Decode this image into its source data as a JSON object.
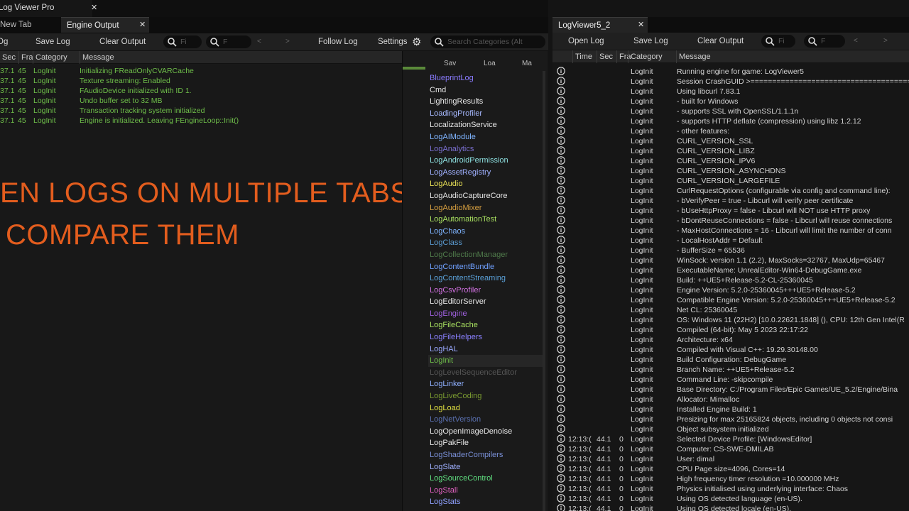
{
  "left": {
    "app_title": "Log Viewer Pro",
    "tabs": [
      "New Tab",
      "Engine Output"
    ],
    "toolbar": {
      "open_label": "Og",
      "save_label": "Save Log",
      "clear_label": "Clear Output",
      "search1_ph": "Fi",
      "search2_ph": "F",
      "follow_label": "Follow Log",
      "settings_label": "Settings"
    },
    "columns": [
      "Sec",
      "Fra",
      "Category",
      "Message"
    ],
    "rows": [
      {
        "sec": "37.1",
        "fra": "45",
        "cat": "LogInit",
        "msg": "Initializing FReadOnlyCVARCache"
      },
      {
        "sec": "37.1",
        "fra": "45",
        "cat": "LogInit",
        "msg": "Texture streaming: Enabled"
      },
      {
        "sec": "37.1",
        "fra": "45",
        "cat": "LogInit",
        "msg": "FAudioDevice initialized with ID 1."
      },
      {
        "sec": "37.1",
        "fra": "45",
        "cat": "LogInit",
        "msg": "Undo buffer set to 32 MB"
      },
      {
        "sec": "37.1",
        "fra": "45",
        "cat": "LogInit",
        "msg": "Transaction tracking system initialized"
      },
      {
        "sec": "37.1",
        "fra": "45",
        "cat": "LogInit",
        "msg": "Engine is initialized. Leaving FEngineLoop::Init()"
      }
    ],
    "hero_line1": "EN LOGS ON MULTIPLE TABS",
    "hero_line2": "COMPARE THEM",
    "category_panel": {
      "search_ph": "Search Categories (Alt",
      "btns": [
        "Sav",
        "Loa",
        "Ma"
      ],
      "categories": [
        {
          "name": "BlueprintLog",
          "color": "#8a7bff"
        },
        {
          "name": "Cmd",
          "color": "#e6e6e6"
        },
        {
          "name": "LightingResults",
          "color": "#e6e6e6"
        },
        {
          "name": "LoadingProfiler",
          "color": "#a7b9ff"
        },
        {
          "name": "LocalizationService",
          "color": "#e6e6e6"
        },
        {
          "name": "LogAIModule",
          "color": "#7fb4ff"
        },
        {
          "name": "LogAnalytics",
          "color": "#7a6fd0"
        },
        {
          "name": "LogAndroidPermission",
          "color": "#8de0e0"
        },
        {
          "name": "LogAssetRegistry",
          "color": "#9fb0ff"
        },
        {
          "name": "LogAudio",
          "color": "#e8e056"
        },
        {
          "name": "LogAudioCaptureCore",
          "color": "#e6e6e6"
        },
        {
          "name": "LogAudioMixer",
          "color": "#d8a040"
        },
        {
          "name": "LogAutomationTest",
          "color": "#a8e060"
        },
        {
          "name": "LogChaos",
          "color": "#7fb4ff"
        },
        {
          "name": "LogClass",
          "color": "#5a9ad0"
        },
        {
          "name": "LogCollectionManager",
          "color": "#4f7a4a"
        },
        {
          "name": "LogContentBundle",
          "color": "#6fa0ff"
        },
        {
          "name": "LogContentStreaming",
          "color": "#5aa0d8"
        },
        {
          "name": "LogCsvProfiler",
          "color": "#d070e0"
        },
        {
          "name": "LogEditorServer",
          "color": "#e6e6e6"
        },
        {
          "name": "LogEngine",
          "color": "#a060e0"
        },
        {
          "name": "LogFileCache",
          "color": "#a8e060"
        },
        {
          "name": "LogFileHelpers",
          "color": "#8a80ff"
        },
        {
          "name": "LogHAL",
          "color": "#9aa8ff"
        },
        {
          "name": "LogInit",
          "color": "#6fbf4a"
        },
        {
          "name": "LogLevelSequenceEditor",
          "color": "#555555"
        },
        {
          "name": "LogLinker",
          "color": "#8fb0ff"
        },
        {
          "name": "LogLiveCoding",
          "color": "#7a9a30"
        },
        {
          "name": "LogLoad",
          "color": "#e0e040"
        },
        {
          "name": "LogNetVersion",
          "color": "#5a70b0"
        },
        {
          "name": "LogOpenImageDenoise",
          "color": "#e6e6e6"
        },
        {
          "name": "LogPakFile",
          "color": "#e6e6e6"
        },
        {
          "name": "LogShaderCompilers",
          "color": "#7a90d8"
        },
        {
          "name": "LogSlate",
          "color": "#9fb0ff"
        },
        {
          "name": "LogSourceControl",
          "color": "#60e080"
        },
        {
          "name": "LogStall",
          "color": "#e060c0"
        },
        {
          "name": "LogStats",
          "color": "#8fa0ff"
        }
      ]
    }
  },
  "right": {
    "title": "LogViewer5_2",
    "toolbar": {
      "open_label": "Open Log",
      "save_label": "Save Log",
      "clear_label": "Clear Output",
      "search1_ph": "Fi",
      "search2_ph": "F"
    },
    "columns": [
      "Time",
      "Sec",
      "Fra",
      "Category",
      "Message"
    ],
    "rows": [
      {
        "time": "",
        "sec": "",
        "fra": "",
        "cat": "LogInit",
        "msg": "Running engine for game: LogViewer5"
      },
      {
        "time": "",
        "sec": "",
        "fra": "",
        "cat": "LogInit",
        "msg": "Session CrashGUID >==========================================="
      },
      {
        "time": "",
        "sec": "",
        "fra": "",
        "cat": "LogInit",
        "msg": "Using libcurl 7.83.1"
      },
      {
        "time": "",
        "sec": "",
        "fra": "",
        "cat": "LogInit",
        "msg": " - built for Windows"
      },
      {
        "time": "",
        "sec": "",
        "fra": "",
        "cat": "LogInit",
        "msg": " - supports SSL with OpenSSL/1.1.1n"
      },
      {
        "time": "",
        "sec": "",
        "fra": "",
        "cat": "LogInit",
        "msg": " - supports HTTP deflate (compression) using libz 1.2.12"
      },
      {
        "time": "",
        "sec": "",
        "fra": "",
        "cat": "LogInit",
        "msg": " - other features:"
      },
      {
        "time": "",
        "sec": "",
        "fra": "",
        "cat": "LogInit",
        "msg": "     CURL_VERSION_SSL"
      },
      {
        "time": "",
        "sec": "",
        "fra": "",
        "cat": "LogInit",
        "msg": "     CURL_VERSION_LIBZ"
      },
      {
        "time": "",
        "sec": "",
        "fra": "",
        "cat": "LogInit",
        "msg": "     CURL_VERSION_IPV6"
      },
      {
        "time": "",
        "sec": "",
        "fra": "",
        "cat": "LogInit",
        "msg": "     CURL_VERSION_ASYNCHDNS"
      },
      {
        "time": "",
        "sec": "",
        "fra": "",
        "cat": "LogInit",
        "msg": "     CURL_VERSION_LARGEFILE"
      },
      {
        "time": "",
        "sec": "",
        "fra": "",
        "cat": "LogInit",
        "msg": " CurlRequestOptions (configurable via config and command line):"
      },
      {
        "time": "",
        "sec": "",
        "fra": "",
        "cat": "LogInit",
        "msg": " - bVerifyPeer = true  - Libcurl will verify peer certificate"
      },
      {
        "time": "",
        "sec": "",
        "fra": "",
        "cat": "LogInit",
        "msg": " - bUseHttpProxy = false  - Libcurl will NOT use HTTP proxy"
      },
      {
        "time": "",
        "sec": "",
        "fra": "",
        "cat": "LogInit",
        "msg": " - bDontReuseConnections = false  - Libcurl will reuse connections"
      },
      {
        "time": "",
        "sec": "",
        "fra": "",
        "cat": "LogInit",
        "msg": " - MaxHostConnections = 16  - Libcurl will limit the number of conn"
      },
      {
        "time": "",
        "sec": "",
        "fra": "",
        "cat": "LogInit",
        "msg": " - LocalHostAddr = Default"
      },
      {
        "time": "",
        "sec": "",
        "fra": "",
        "cat": "LogInit",
        "msg": " - BufferSize = 65536"
      },
      {
        "time": "",
        "sec": "",
        "fra": "",
        "cat": "LogInit",
        "msg": "WinSock: version 1.1 (2.2), MaxSocks=32767, MaxUdp=65467"
      },
      {
        "time": "",
        "sec": "",
        "fra": "",
        "cat": "LogInit",
        "msg": "ExecutableName: UnrealEditor-Win64-DebugGame.exe"
      },
      {
        "time": "",
        "sec": "",
        "fra": "",
        "cat": "LogInit",
        "msg": "Build: ++UE5+Release-5.2-CL-25360045"
      },
      {
        "time": "",
        "sec": "",
        "fra": "",
        "cat": "LogInit",
        "msg": "Engine Version: 5.2.0-25360045+++UE5+Release-5.2"
      },
      {
        "time": "",
        "sec": "",
        "fra": "",
        "cat": "LogInit",
        "msg": "Compatible Engine Version: 5.2.0-25360045+++UE5+Release-5.2"
      },
      {
        "time": "",
        "sec": "",
        "fra": "",
        "cat": "LogInit",
        "msg": "Net CL: 25360045"
      },
      {
        "time": "",
        "sec": "",
        "fra": "",
        "cat": "LogInit",
        "msg": "OS: Windows 11 (22H2) [10.0.22621.1848] (), CPU: 12th Gen Intel(R"
      },
      {
        "time": "",
        "sec": "",
        "fra": "",
        "cat": "LogInit",
        "msg": "Compiled (64-bit): May  5 2023 22:17:22"
      },
      {
        "time": "",
        "sec": "",
        "fra": "",
        "cat": "LogInit",
        "msg": "Architecture: x64"
      },
      {
        "time": "",
        "sec": "",
        "fra": "",
        "cat": "LogInit",
        "msg": "Compiled with Visual C++: 19.29.30148.00"
      },
      {
        "time": "",
        "sec": "",
        "fra": "",
        "cat": "LogInit",
        "msg": "Build Configuration: DebugGame"
      },
      {
        "time": "",
        "sec": "",
        "fra": "",
        "cat": "LogInit",
        "msg": "Branch Name: ++UE5+Release-5.2"
      },
      {
        "time": "",
        "sec": "",
        "fra": "",
        "cat": "LogInit",
        "msg": "Command Line: -skipcompile"
      },
      {
        "time": "",
        "sec": "",
        "fra": "",
        "cat": "LogInit",
        "msg": "Base Directory: C:/Program Files/Epic Games/UE_5.2/Engine/Bina"
      },
      {
        "time": "",
        "sec": "",
        "fra": "",
        "cat": "LogInit",
        "msg": "Allocator: Mimalloc"
      },
      {
        "time": "",
        "sec": "",
        "fra": "",
        "cat": "LogInit",
        "msg": "Installed Engine Build: 1"
      },
      {
        "time": "",
        "sec": "",
        "fra": "",
        "cat": "LogInit",
        "msg": "Presizing for max 25165824 objects, including 0 objects not consi"
      },
      {
        "time": "",
        "sec": "",
        "fra": "",
        "cat": "LogInit",
        "msg": "Object subsystem initialized"
      },
      {
        "time": "12:13:(",
        "sec": "44.1",
        "fra": "0",
        "cat": "LogInit",
        "msg": "Selected Device Profile: [WindowsEditor]"
      },
      {
        "time": "12:13:(",
        "sec": "44.1",
        "fra": "0",
        "cat": "LogInit",
        "msg": "Computer: CS-SWE-DMILAB"
      },
      {
        "time": "12:13:(",
        "sec": "44.1",
        "fra": "0",
        "cat": "LogInit",
        "msg": "User: dimal"
      },
      {
        "time": "12:13:(",
        "sec": "44.1",
        "fra": "0",
        "cat": "LogInit",
        "msg": "CPU Page size=4096, Cores=14"
      },
      {
        "time": "12:13:(",
        "sec": "44.1",
        "fra": "0",
        "cat": "LogInit",
        "msg": "High frequency timer resolution =10.000000 MHz"
      },
      {
        "time": "12:13:(",
        "sec": "44.1",
        "fra": "0",
        "cat": "LogInit",
        "msg": "Physics initialised using underlying interface: Chaos"
      },
      {
        "time": "12:13:(",
        "sec": "44.1",
        "fra": "0",
        "cat": "LogInit",
        "msg": "Using OS detected language (en-US)."
      },
      {
        "time": "12:13:(",
        "sec": "44.1",
        "fra": "0",
        "cat": "LogInit",
        "msg": "Using OS detected locale (en-US)."
      }
    ]
  }
}
